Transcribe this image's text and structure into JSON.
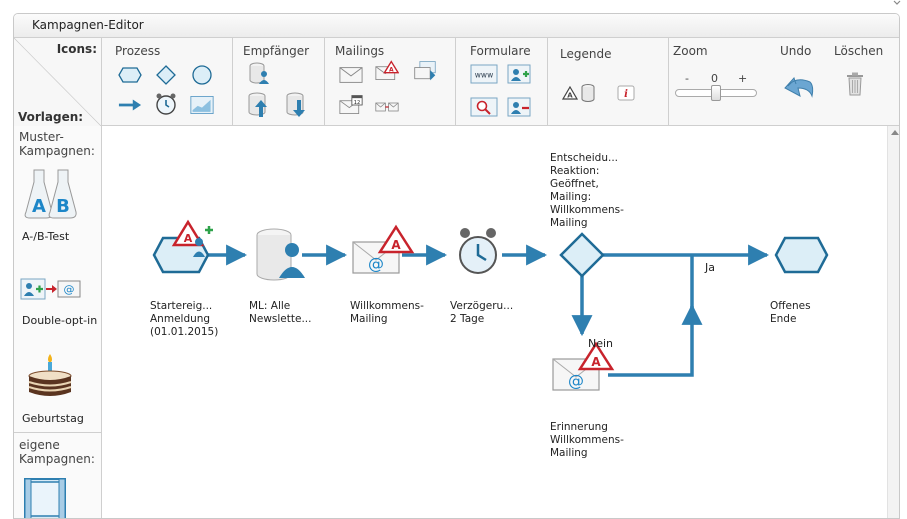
{
  "window": {
    "title": "Kampagnen-Editor"
  },
  "toolbar": {
    "icons_label": "Icons:",
    "templates_label": "Vorlagen:",
    "groups": {
      "prozess": "Prozess",
      "empfaenger": "Empfänger",
      "mailings": "Mailings",
      "formulare": "Formulare",
      "legende": "Legende",
      "zoom": "Zoom",
      "undo": "Undo",
      "loeschen": "Löschen"
    },
    "zoom": {
      "minus": "-",
      "value": "0",
      "plus": "+",
      "level": 0.5
    },
    "form_www": "www"
  },
  "sidebar": {
    "muster_title_1": "Muster-",
    "muster_title_2": "Kampagnen:",
    "templates": [
      {
        "label": "A-/B-Test",
        "icon": "ab-test-flask-icon"
      },
      {
        "label": "Double-opt-in",
        "icon": "double-opt-in-icon"
      },
      {
        "label": "Geburtstag",
        "icon": "birthday-cake-icon"
      }
    ],
    "eigene_title_1": "eigene",
    "eigene_title_2": "Kampagnen:",
    "ab_letters": {
      "a": "A",
      "b": "B"
    }
  },
  "canvas": {
    "nodes": [
      {
        "id": "start",
        "lines": [
          "Startereig...",
          "Anmeldung",
          "(01.01.2015)"
        ],
        "icon": "start-event-icon"
      },
      {
        "id": "list",
        "lines": [
          "ML: Alle",
          "Newslette..."
        ],
        "icon": "recipient-list-icon"
      },
      {
        "id": "welcome",
        "lines": [
          "Willkommens-",
          "Mailing"
        ],
        "icon": "mailing-icon"
      },
      {
        "id": "delay",
        "lines": [
          "Verzögeru...",
          "2 Tage"
        ],
        "icon": "delay-clock-icon"
      },
      {
        "id": "decision",
        "lines": [
          "Entscheidu...",
          "Reaktion:",
          "Geöffnet,",
          "Mailing:",
          "Willkommens-",
          "Mailing"
        ],
        "icon": "decision-diamond-icon"
      },
      {
        "id": "end",
        "lines": [
          "Offenes",
          "Ende"
        ],
        "icon": "end-event-icon"
      },
      {
        "id": "reminder",
        "lines": [
          "Erinnerung",
          "Willkommens-",
          "Mailing"
        ],
        "icon": "mailing-icon"
      }
    ],
    "edge_labels": {
      "yes": "Ja",
      "no": "Nein"
    },
    "warning_mark": "A",
    "email_at": "@"
  },
  "colors": {
    "flow": "#2e7fb0",
    "node_fill": "#dceef7",
    "node_stroke": "#1f6b96",
    "warning_red": "#c8232c",
    "border": "#cfcfcf"
  }
}
